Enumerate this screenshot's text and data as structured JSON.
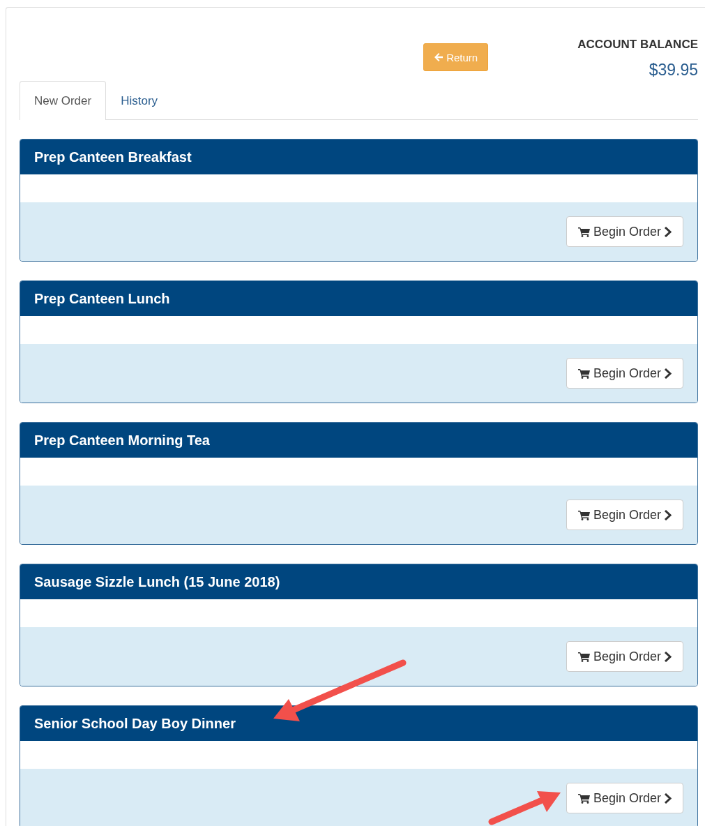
{
  "return_button": {
    "label": "Return"
  },
  "account_balance": {
    "label": "ACCOUNT BALANCE",
    "amount": "$39.95"
  },
  "tabs": [
    {
      "label": "New Order",
      "selected": true
    },
    {
      "label": "History",
      "selected": false
    }
  ],
  "menus": [
    {
      "title": "Prep Canteen Breakfast",
      "button": "Begin Order"
    },
    {
      "title": "Prep Canteen Lunch",
      "button": "Begin Order"
    },
    {
      "title": "Prep Canteen Morning Tea",
      "button": "Begin Order"
    },
    {
      "title": "Sausage Sizzle Lunch (15 June 2018)",
      "button": "Begin Order"
    },
    {
      "title": "Senior School Day Boy Dinner",
      "button": "Begin Order"
    }
  ]
}
